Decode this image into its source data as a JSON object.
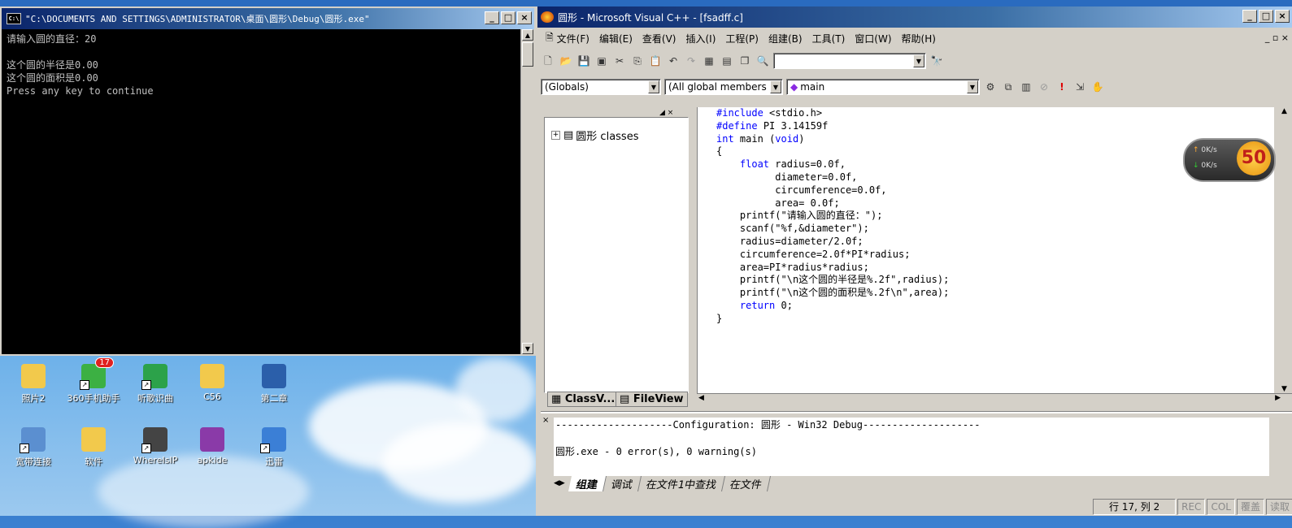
{
  "console": {
    "title": "\"C:\\DOCUMENTS AND SETTINGS\\ADMINISTRATOR\\桌面\\圆形\\Debug\\圆形.exe\"",
    "lines": [
      "请输入圆的直径：20",
      "",
      "这个圆的半径是0.00",
      "这个圆的面积是0.00",
      "Press any key to continue"
    ]
  },
  "desktop": {
    "icons": [
      {
        "label": "照片2",
        "icon": "folder-icon",
        "color": "#f2c94c"
      },
      {
        "label": "360手机助手",
        "icon": "phone-assistant-icon",
        "color": "#3cb043",
        "badge": "17"
      },
      {
        "label": "听歌识曲",
        "icon": "music-recognition-icon",
        "color": "#2ca24a"
      },
      {
        "label": "C56",
        "icon": "folder-icon",
        "color": "#f2c94c"
      },
      {
        "label": "第二章",
        "icon": "word-document-icon",
        "color": "#2b5faa"
      },
      {
        "label": "宽带连接",
        "icon": "network-connection-icon",
        "color": "#5b8fd0"
      },
      {
        "label": "软件",
        "icon": "folder-icon",
        "color": "#f2c94c"
      },
      {
        "label": "WhereIsIP",
        "icon": "whereisip-icon",
        "color": "#444444"
      },
      {
        "label": "apkide",
        "icon": "archive-icon",
        "color": "#8a3aa8"
      },
      {
        "label": "迅雷",
        "icon": "thunder-icon",
        "color": "#3b7fd6"
      }
    ]
  },
  "vc": {
    "title": "圆形 - Microsoft Visual C++ - [fsadff.c]",
    "menu": [
      "文件(F)",
      "编辑(E)",
      "查看(V)",
      "插入(I)",
      "工程(P)",
      "组建(B)",
      "工具(T)",
      "窗口(W)",
      "帮助(H)"
    ],
    "combo_globals": "(Globals)",
    "combo_members": "(All global members",
    "combo_main": "main",
    "tree_root": "圆形 classes",
    "tabs": {
      "classview": "ClassV...",
      "fileview": "FileView"
    },
    "code_lines": [
      "#include <stdio.h>",
      "#define PI 3.14159f",
      "int main (void)",
      "{",
      "    float radius=0.0f,",
      "          diameter=0.0f,",
      "          circumference=0.0f,",
      "          area= 0.0f;",
      "    printf(\"请输入圆的直径：\");",
      "    scanf(\"%f,&diameter\");",
      "    radius=diameter/2.0f;",
      "    circumference=2.0f*PI*radius;",
      "    area=PI*radius*radius;",
      "    printf(\"\\n这个圆的半径是%.2f\",radius);",
      "    printf(\"\\n这个圆的面积是%.2f\\n\",area);",
      "    return 0;",
      "}"
    ],
    "output_lines": [
      "--------------------Configuration: 圆形 - Win32 Debug--------------------",
      "",
      "圆形.exe - 0 error(s), 0 warning(s)"
    ],
    "output_tabs": [
      "组建",
      "调试",
      "在文件1中查找",
      "在文件"
    ],
    "status": {
      "position": "行 17, 列 2",
      "rec": "REC",
      "col": "COL",
      "ovr": "覆盖",
      "read": "读取"
    }
  },
  "speed_widget": {
    "up": "0K/s",
    "down": "0K/s",
    "value": "50"
  }
}
